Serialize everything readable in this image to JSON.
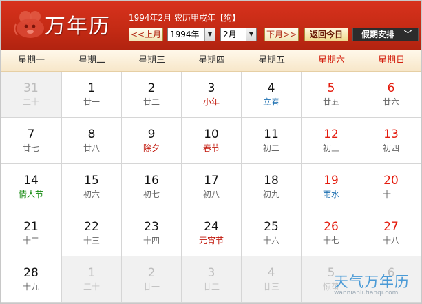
{
  "header": {
    "logo_text": "万年历",
    "info": "1994年2月 农历甲戌年【狗】",
    "prev_month": "<<上月",
    "year_value": "1994年",
    "month_value": "2月",
    "next_month": "下月>>",
    "today": "返回今日",
    "holiday": "假期安排"
  },
  "weekdays": [
    "星期一",
    "星期二",
    "星期三",
    "星期四",
    "星期五",
    "星期六",
    "星期日"
  ],
  "weeks": [
    [
      {
        "day": "31",
        "lunar": "二十",
        "other": true
      },
      {
        "day": "1",
        "lunar": "廿一"
      },
      {
        "day": "2",
        "lunar": "廿二"
      },
      {
        "day": "3",
        "lunar": "小年",
        "style": "festival"
      },
      {
        "day": "4",
        "lunar": "立春",
        "style": "term"
      },
      {
        "day": "5",
        "lunar": "廿五"
      },
      {
        "day": "6",
        "lunar": "廿六"
      }
    ],
    [
      {
        "day": "7",
        "lunar": "廿七"
      },
      {
        "day": "8",
        "lunar": "廿八"
      },
      {
        "day": "9",
        "lunar": "除夕",
        "style": "festival"
      },
      {
        "day": "10",
        "lunar": "春节",
        "style": "festival"
      },
      {
        "day": "11",
        "lunar": "初二"
      },
      {
        "day": "12",
        "lunar": "初三"
      },
      {
        "day": "13",
        "lunar": "初四"
      }
    ],
    [
      {
        "day": "14",
        "lunar": "情人节",
        "style": "intl"
      },
      {
        "day": "15",
        "lunar": "初六"
      },
      {
        "day": "16",
        "lunar": "初七"
      },
      {
        "day": "17",
        "lunar": "初八"
      },
      {
        "day": "18",
        "lunar": "初九"
      },
      {
        "day": "19",
        "lunar": "雨水",
        "style": "term"
      },
      {
        "day": "20",
        "lunar": "十一"
      }
    ],
    [
      {
        "day": "21",
        "lunar": "十二"
      },
      {
        "day": "22",
        "lunar": "十三"
      },
      {
        "day": "23",
        "lunar": "十四"
      },
      {
        "day": "24",
        "lunar": "元宵节",
        "style": "festival"
      },
      {
        "day": "25",
        "lunar": "十六"
      },
      {
        "day": "26",
        "lunar": "十七"
      },
      {
        "day": "27",
        "lunar": "十八"
      }
    ],
    [
      {
        "day": "28",
        "lunar": "十九"
      },
      {
        "day": "1",
        "lunar": "二十",
        "other": true
      },
      {
        "day": "2",
        "lunar": "廿一",
        "other": true
      },
      {
        "day": "3",
        "lunar": "廿二",
        "other": true
      },
      {
        "day": "4",
        "lunar": "廿三",
        "other": true
      },
      {
        "day": "5",
        "lunar": "惊蛰",
        "other": true
      },
      {
        "day": "6",
        "lunar": "",
        "other": true
      }
    ]
  ],
  "watermark": {
    "title": "天气万年历",
    "url": "wannianli.tianqi.com"
  },
  "colors": {
    "header_red": "#c32a14",
    "weekend_red": "#e41b0d",
    "term_blue": "#1c6fb0",
    "festival_red": "#c1170b",
    "intl_green": "#138a0e"
  }
}
